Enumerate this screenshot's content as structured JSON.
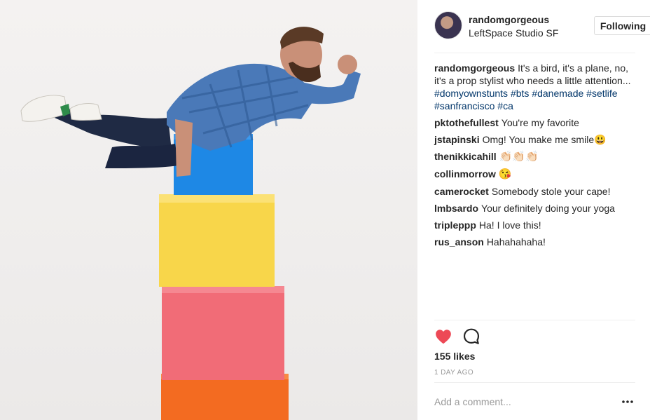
{
  "post": {
    "username": "randomgorgeous",
    "location": "LeftSpace Studio SF",
    "follow_label": "Following",
    "caption": {
      "author": "randomgorgeous",
      "text": "It's a bird, it's a plane, no, it's a prop stylist who needs a little attention... ",
      "tags": [
        "#domyownstunts",
        "#bts",
        "#danemade",
        "#setlife",
        "#sanfrancisco",
        "#ca"
      ]
    },
    "comments": [
      {
        "author": "pktothefullest",
        "text": "You're my favorite"
      },
      {
        "author": "jstapinski",
        "text": "Omg! You make me smile😃"
      },
      {
        "author": "thenikkicahill",
        "text": "👏🏻👏🏻👏🏻"
      },
      {
        "author": "collinmorrow",
        "text": "😘"
      },
      {
        "author": "camerocket",
        "text": "Somebody stole your cape!"
      },
      {
        "author": "lmbsardo",
        "text": "Your definitely doing your yoga"
      },
      {
        "author": "tripleppp",
        "text": "Ha! I love this!"
      },
      {
        "author": "rus_anson",
        "text": "Hahahahaha!"
      }
    ],
    "likes": "155 likes",
    "time": "1 DAY AGO",
    "comment_placeholder": "Add a comment...",
    "more_label": "•••",
    "icons": {
      "like": "heart-icon",
      "comment": "comment-icon",
      "more": "more-icon"
    },
    "colors": {
      "like": "#ed4956",
      "tag": "#003569",
      "muted": "#999999",
      "text": "#262626"
    }
  }
}
